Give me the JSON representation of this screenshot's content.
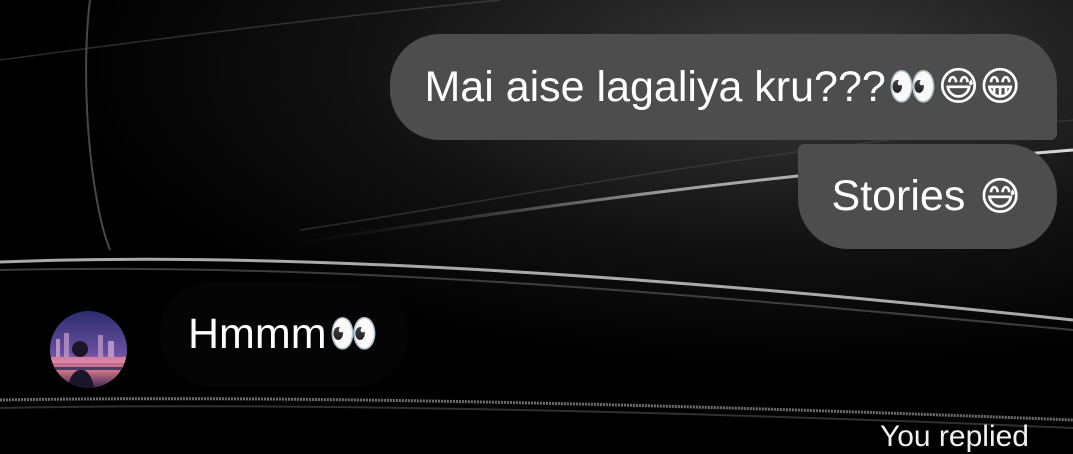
{
  "thread": {
    "messages": [
      {
        "sender": "me",
        "text": "Mai aise lagaliya kru???",
        "emoji": "👀😅😁"
      },
      {
        "sender": "me",
        "text": "Stories ",
        "emoji": "😅"
      },
      {
        "sender": "other",
        "text": "Hmmm",
        "emoji": "👀"
      }
    ],
    "footer_text": "You replied"
  },
  "colors": {
    "background": "#000000",
    "outgoing_bubble": "#4d4d4d",
    "incoming_bubble": "#050505",
    "text": "#ffffff"
  }
}
